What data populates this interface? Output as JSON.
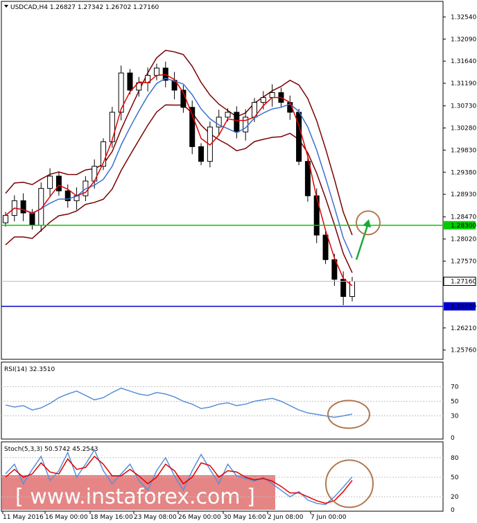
{
  "header": {
    "symbol_line": "USDCAD,H4  1.26827 1.27342 1.26702 1.27160"
  },
  "colors": {
    "candle": "#000000",
    "ma_fast": "#e00000",
    "ma_slow": "#3b6fd0",
    "bands": "#7a0000",
    "resistance": "#00cc00",
    "support": "#0000cc",
    "arrow": "#1aaa3a",
    "circle": "#b07850",
    "rsi_line": "#5b8fd8",
    "stoch_main": "#5b8fd8",
    "stoch_signal": "#e00000",
    "watermark_bg": "#e07070"
  },
  "chart_data": [
    {
      "type": "candlestick",
      "title": "USDCAD,H4",
      "ohlc_last": {
        "open": 1.26827,
        "high": 1.27342,
        "low": 1.26702,
        "close": 1.2716
      },
      "ylim": [
        1.256,
        1.328
      ],
      "y_ticks": [
        "1.32540",
        "1.32090",
        "1.31640",
        "1.31190",
        "1.30730",
        "1.30280",
        "1.29830",
        "1.29380",
        "1.28930",
        "1.28470",
        "1.28020",
        "1.27570",
        "1.26210",
        "1.25760"
      ],
      "x_ticks": [
        "11 May 2016",
        "16 May 00:00",
        "18 May 16:00",
        "23 May 08:00",
        "26 May 00:00",
        "30 May 16:00",
        "2 Jun 08:00",
        "7 Jun 00:00"
      ],
      "close_path": [
        1.285,
        1.288,
        1.2855,
        1.283,
        1.2905,
        1.293,
        1.29,
        1.288,
        1.289,
        1.292,
        1.295,
        1.3,
        1.306,
        1.314,
        1.3105,
        1.312,
        1.3135,
        1.315,
        1.3125,
        1.3105,
        1.307,
        1.299,
        1.296,
        1.303,
        1.305,
        1.306,
        1.302,
        1.305,
        1.308,
        1.309,
        1.31,
        1.308,
        1.306,
        1.296,
        1.289,
        1.281,
        1.276,
        1.272,
        1.2685,
        1.2716
      ],
      "levels": [
        {
          "label": "1.28300",
          "value": 1.283
        },
        {
          "label": "1.26650",
          "value": 1.2665
        }
      ],
      "price_tag": "1.27160",
      "series": [
        {
          "name": "",
          "role": "fast moving average",
          "color": "#e00000"
        },
        {
          "name": "",
          "role": "slow moving average",
          "color": "#3b6fd0"
        },
        {
          "name": "",
          "role": "upper and lower envelope bands",
          "color": "#7a0000"
        }
      ]
    },
    {
      "type": "line",
      "label": "RSI(14) 32.3510",
      "ylim": [
        0,
        100
      ],
      "y_ticks": [
        "70",
        "50",
        "30",
        "0"
      ],
      "values": [
        45,
        42,
        44,
        38,
        41,
        47,
        55,
        60,
        64,
        58,
        52,
        55,
        62,
        68,
        64,
        60,
        58,
        62,
        60,
        56,
        50,
        46,
        40,
        42,
        46,
        48,
        44,
        46,
        50,
        52,
        54,
        50,
        44,
        38,
        34,
        32,
        30,
        28,
        30,
        32.35
      ]
    },
    {
      "type": "line",
      "label": "Stoch(5,3,3) 50.5742 45.2543",
      "ylim": [
        0,
        100
      ],
      "y_ticks": [
        "80",
        "50",
        "20",
        "0"
      ],
      "series": [
        {
          "name": "",
          "role": "main",
          "values": [
            55,
            70,
            40,
            62,
            82,
            45,
            60,
            88,
            50,
            70,
            92,
            60,
            40,
            55,
            70,
            45,
            30,
            60,
            80,
            52,
            30,
            60,
            85,
            62,
            40,
            70,
            52,
            48,
            44,
            50,
            40,
            30,
            20,
            28,
            15,
            10,
            8,
            20,
            35,
            50.57
          ]
        },
        {
          "name": "",
          "role": "signal",
          "values": [
            50,
            62,
            50,
            55,
            72,
            58,
            55,
            78,
            62,
            65,
            82,
            70,
            52,
            52,
            62,
            52,
            40,
            50,
            70,
            60,
            40,
            50,
            72,
            68,
            50,
            60,
            58,
            50,
            46,
            48,
            44,
            36,
            26,
            26,
            20,
            14,
            10,
            14,
            28,
            45.25
          ]
        }
      ]
    }
  ],
  "watermark": "[ www.instaforex.com ]"
}
